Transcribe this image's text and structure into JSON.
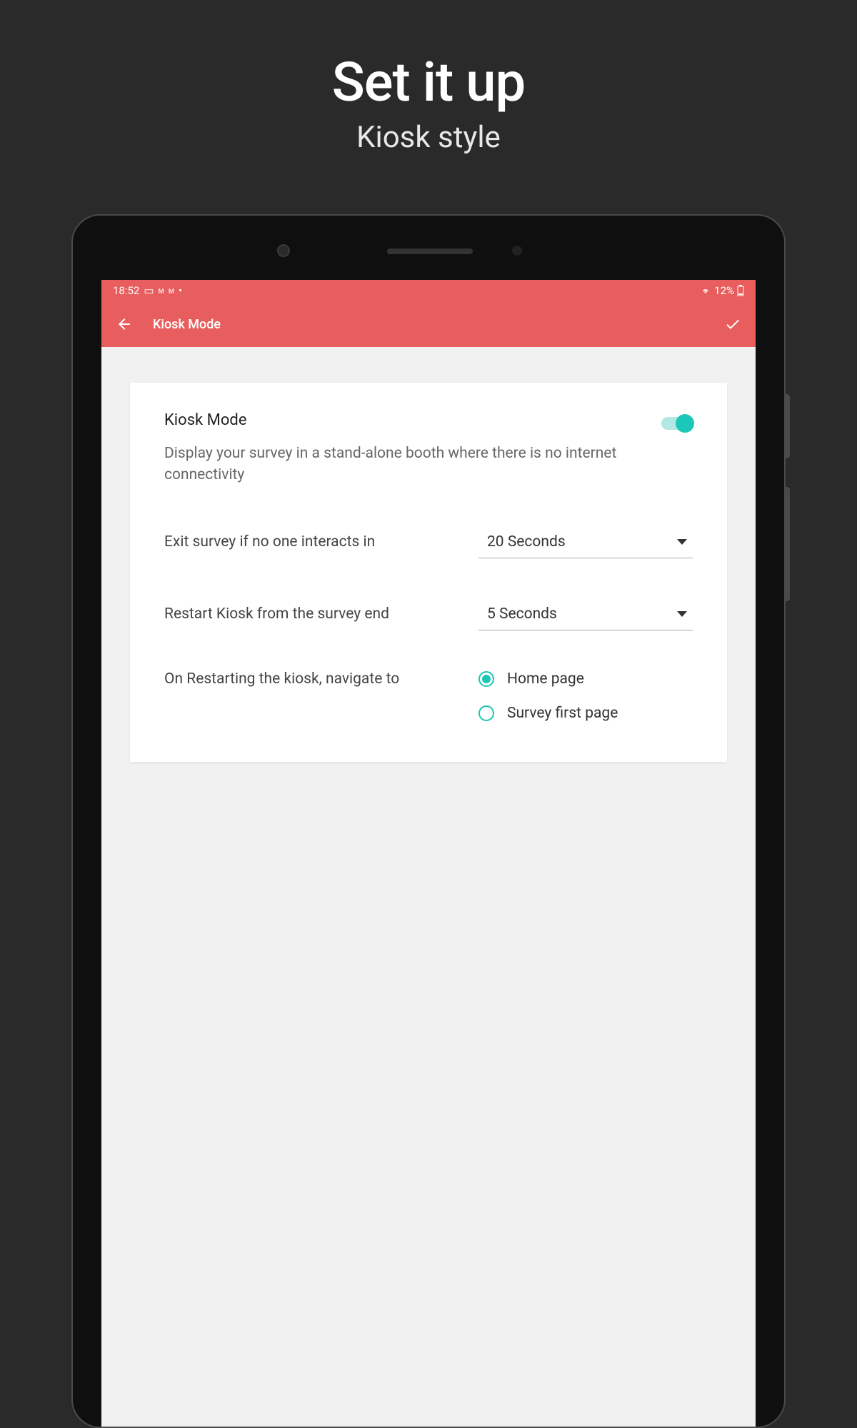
{
  "hero": {
    "title": "Set it up",
    "subtitle": "Kiosk style"
  },
  "statusBar": {
    "time": "18:52",
    "batteryText": "12%"
  },
  "appBar": {
    "title": "Kiosk Mode"
  },
  "card": {
    "sectionTitle": "Kiosk Mode",
    "toggleOn": true,
    "description": "Display your survey in a stand-alone booth where there is no internet connectivity",
    "exitLabel": "Exit survey if no one interacts in",
    "exitValue": "20 Seconds",
    "restartLabel": "Restart Kiosk from the survey end",
    "restartValue": "5 Seconds",
    "navLabel": "On Restarting the kiosk, navigate to",
    "navOptions": {
      "opt1": "Home page",
      "opt2": "Survey first page"
    },
    "navSelected": "opt1"
  },
  "colors": {
    "accent": "#e85e5e",
    "teal": "#1bc7b8"
  }
}
